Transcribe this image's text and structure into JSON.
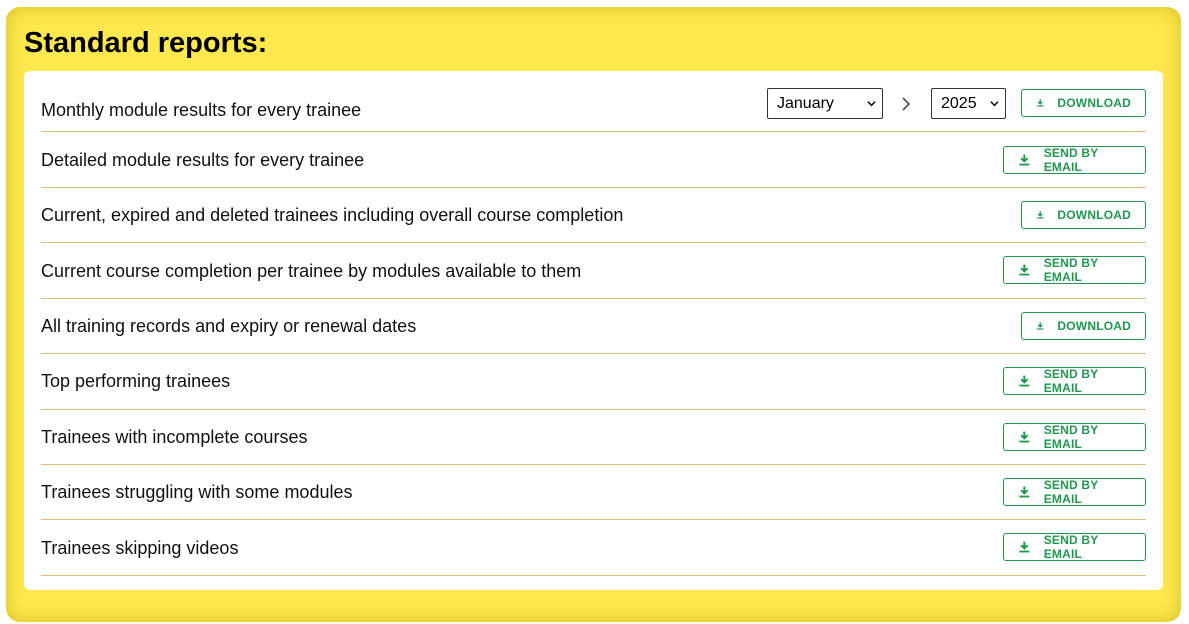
{
  "panel": {
    "title": "Standard reports:"
  },
  "filters": {
    "month": "January",
    "year": "2025"
  },
  "reports": [
    {
      "label": "Monthly module results for every trainee",
      "action": "DOWNLOAD"
    },
    {
      "label": "Detailed module results for every trainee",
      "action": "SEND BY EMAIL"
    },
    {
      "label": "Current, expired and deleted trainees including overall course completion",
      "action": "DOWNLOAD"
    },
    {
      "label": "Current course completion per trainee by modules available to them",
      "action": "SEND BY EMAIL"
    },
    {
      "label": "All training records and expiry or renewal dates",
      "action": "DOWNLOAD"
    },
    {
      "label": "Top performing trainees",
      "action": "SEND BY EMAIL"
    },
    {
      "label": "Trainees with incomplete courses",
      "action": "SEND BY EMAIL"
    },
    {
      "label": "Trainees struggling with some modules",
      "action": "SEND BY EMAIL"
    },
    {
      "label": "Trainees skipping videos",
      "action": "SEND BY EMAIL"
    }
  ],
  "colors": {
    "panel_bg": "#fde84d",
    "button_accent": "#1e9a4c",
    "row_divider": "#d9c07a"
  },
  "icons": {
    "action_icon": "download-icon",
    "select_icon": "chevron-down-icon",
    "next_icon": "chevron-right-icon"
  }
}
